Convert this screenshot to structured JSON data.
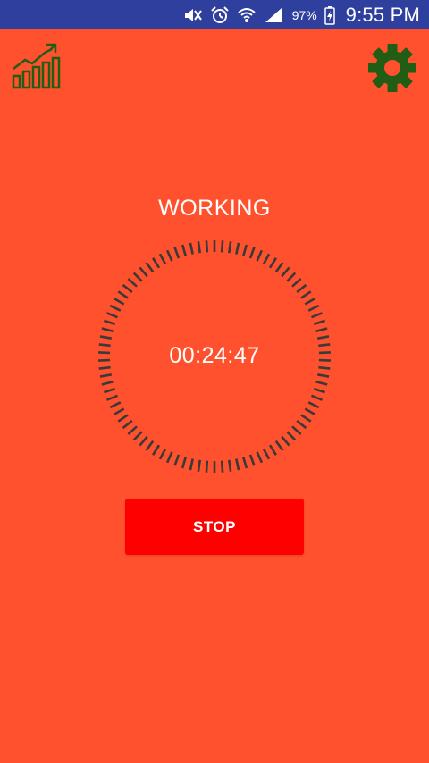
{
  "status_bar": {
    "battery_percent": "97%",
    "time": "9:55 PM",
    "icons": [
      "mute-icon",
      "alarm-icon",
      "wifi-icon",
      "signal-icon",
      "battery-charging-icon"
    ]
  },
  "toolbar": {
    "left_icon": "stats-chart-icon",
    "right_icon": "gear-icon"
  },
  "timer": {
    "state_label": "WORKING",
    "time_display": "00:24:47",
    "stop_label": "STOP"
  },
  "colors": {
    "background": "#ff512d",
    "status_bar": "#2e3f9e",
    "icon_green": "#215d15",
    "dial_ticks": "#3a3a3a",
    "stop_button": "#ff0000",
    "text": "#ffffff"
  }
}
